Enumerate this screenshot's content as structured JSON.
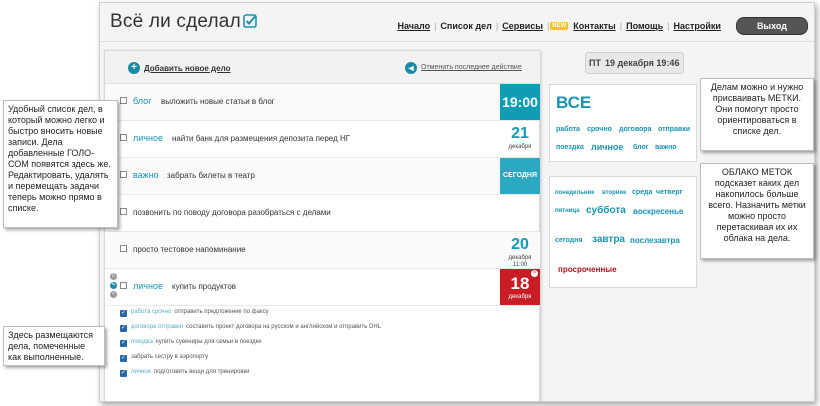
{
  "app": {
    "logo": "Всё ли сделал"
  },
  "nav": {
    "items": [
      "Начало",
      "Список дел",
      "Сервисы",
      "Контакты",
      "Помощь",
      "Настройки"
    ],
    "new_badge": "NEW",
    "exit": "Выход"
  },
  "actions": {
    "add_label": "Добавить новое дело",
    "undo_label": "Отменить последнее действие"
  },
  "tasks": [
    {
      "tag": "блог",
      "text": "выложить новые статьи в блог",
      "time": "19:00"
    },
    {
      "tag": "личное",
      "text": "найти банк для размещения депозита перед НГ",
      "day": "21",
      "month": "декабря"
    },
    {
      "tag": "важно",
      "text": "забрать билеты в театр",
      "badge": "СЕГОДНЯ"
    },
    {
      "tag": "",
      "text": "позвонить по поводу договора разобраться с делами"
    },
    {
      "tag": "",
      "text": "просто тестовое напоминание",
      "day": "20",
      "month": "декабря",
      "time": "11:00"
    },
    {
      "tag": "личное",
      "text": "купить продуктов",
      "day": "18",
      "month": "декабря"
    }
  ],
  "done": [
    {
      "tags": "работа срочно",
      "text": "отправить предложение по факсу"
    },
    {
      "tags": "договора отправки",
      "text": "составить проект договора на русском и английском и отправить DHL"
    },
    {
      "tags": "поездка",
      "text": "купить сувениры для семьи в поездке"
    },
    {
      "tags": "",
      "text": "забрать сестру в аэропорту"
    },
    {
      "tags": "личное",
      "text": "подготовить вещи для тренировки"
    }
  ],
  "date": {
    "dow": "ПТ",
    "full": "19 декабря 19:46"
  },
  "tags_box": {
    "all": "ВСЕ",
    "tags": [
      "работа",
      "срочно",
      "договора",
      "отправки",
      "поездка",
      "личное",
      "блог",
      "важно"
    ]
  },
  "cloud": {
    "days": [
      "понедельник",
      "вторник",
      "среда",
      "четверг"
    ],
    "friday": "пятница",
    "saturday": "суббота",
    "sunday": "воскресенье",
    "today": "сегодня",
    "tomorrow": "завтра",
    "after_tomorrow": "послезавтра",
    "overdue": "просроченные"
  },
  "callouts": {
    "list": "Удобный список дел, в который можно легко и быстро вносить новые записи. Дела добавленные ГОЛО-СОМ появятся здесь же. Редактировать, удалять и перемещать задачи теперь можно прямо в списке.",
    "done": "Здесь размещаются дела, помеченные как выполненные.",
    "tags": "Делам можно и нужно присваивать МЕТКИ. Они помогут просто ориентироваться в списке дел.",
    "cloud": "ОБЛАКО МЕТОК подсказет каких дел накопилось больше всего. Назначить метки можно просто перетаскивая их их облака на дела."
  },
  "colors": {
    "accent": "#1a93b3",
    "today": "#2ba9c1",
    "overdue": "#c81d25"
  }
}
